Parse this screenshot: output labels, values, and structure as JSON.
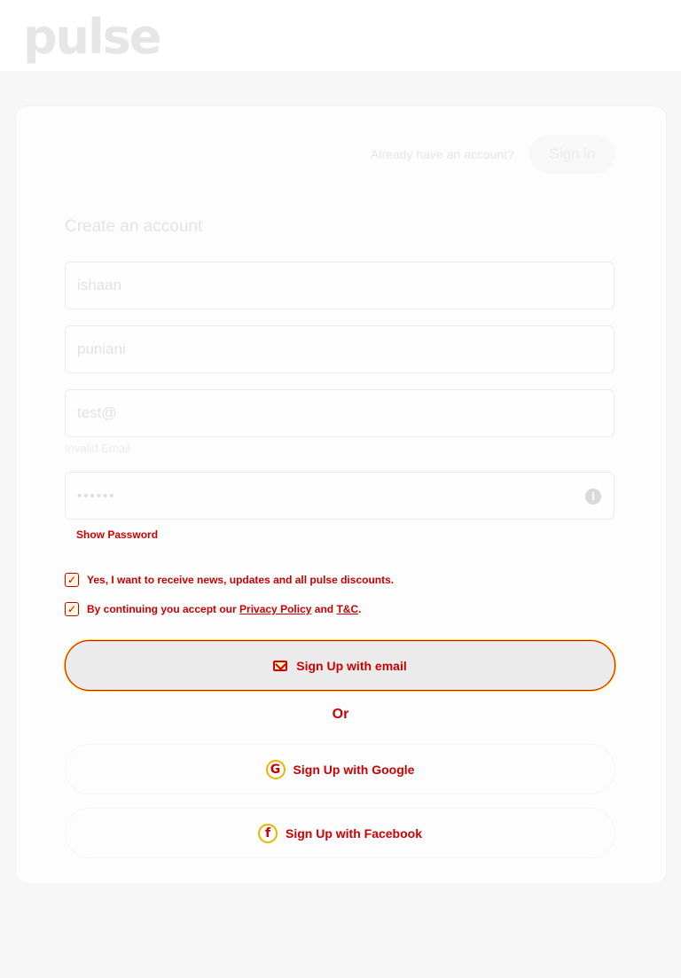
{
  "header": {
    "logo": "pulse"
  },
  "card": {
    "already_text": "Already have an account?",
    "signin_label": "Sign in",
    "title": "Create an account"
  },
  "form": {
    "first_name": {
      "value": "ishaan"
    },
    "last_name": {
      "value": "puniani"
    },
    "email": {
      "value": "test@",
      "error": "Invalid Email"
    },
    "password": {
      "value": "••••••",
      "show_label": "Show Password",
      "info_icon": "info-icon"
    }
  },
  "consents": {
    "news": {
      "checked": true,
      "label": "Yes, I want to receive news, updates and all pulse discounts."
    },
    "terms": {
      "checked": true,
      "prefix": "By continuing you accept our",
      "privacy_link": "Privacy Policy",
      "and": "and",
      "tc_link": "T&C",
      "suffix": "."
    }
  },
  "actions": {
    "email_label": "Sign Up with email",
    "or_label": "Or",
    "google_label": "Sign Up with Google",
    "facebook_label": "Sign Up with Facebook"
  },
  "colors": {
    "accent": "#cc0000",
    "highlight": "#f5e000",
    "background": "#f7f7f7"
  }
}
